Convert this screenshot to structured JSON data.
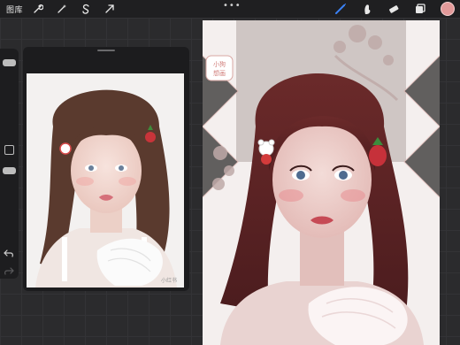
{
  "toolbar": {
    "gallery_label": "图库",
    "more_label": "•••",
    "left_icons": [
      "wrench-icon",
      "magic-wand-icon",
      "selection-s-icon",
      "transform-arrow-icon"
    ],
    "right_icons": [
      "brush-icon",
      "smudge-icon",
      "eraser-icon",
      "layers-icon"
    ],
    "current_color": "#e39a9a",
    "active_tool_color": "#3b82f6"
  },
  "sidebar": {
    "controls": [
      "brush-size-slider",
      "modify-button",
      "opacity-slider",
      "undo-button",
      "redo-button"
    ]
  },
  "reference": {
    "title": "reference-window",
    "photo_watermark": "小红书"
  },
  "canvas": {
    "sticker_text": "小狗\n想画"
  }
}
